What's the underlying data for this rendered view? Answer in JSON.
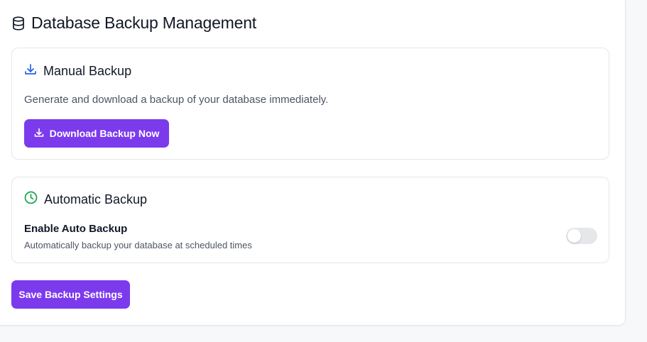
{
  "page": {
    "title": "Database Backup Management",
    "title_icon": "database-icon"
  },
  "manual_backup": {
    "title": "Manual Backup",
    "icon": "download-icon",
    "icon_color": "#2563eb",
    "description": "Generate and download a backup of your database immediately.",
    "button_label": "Download Backup Now",
    "button_icon": "download-icon"
  },
  "automatic_backup": {
    "title": "Automatic Backup",
    "icon": "clock-icon",
    "icon_color": "#16a34a",
    "setting_label": "Enable Auto Backup",
    "setting_help": "Automatically backup your database at scheduled times",
    "enabled": false
  },
  "footer": {
    "save_label": "Save Backup Settings"
  },
  "colors": {
    "accent": "#7c3aed",
    "toggle_off": "#e5e7eb"
  }
}
